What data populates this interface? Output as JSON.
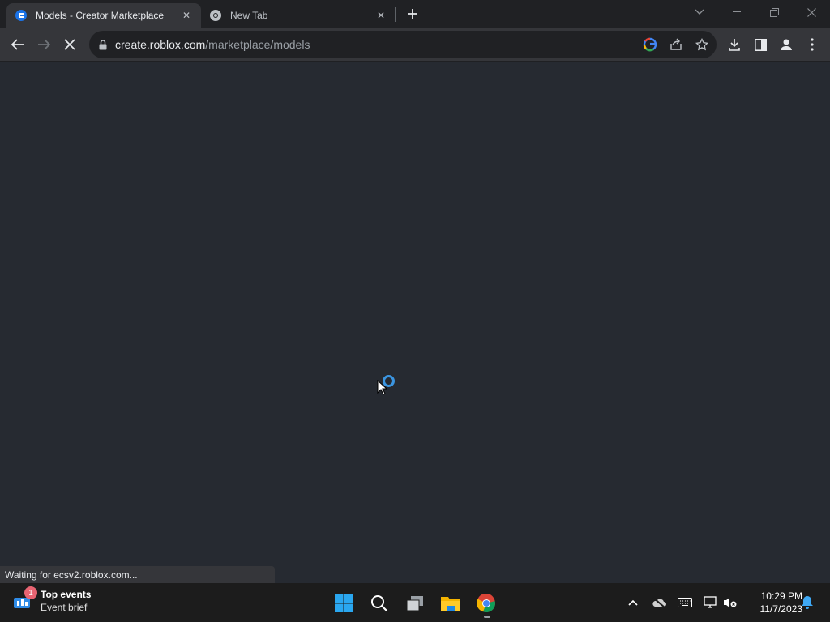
{
  "browser": {
    "tabs": [
      {
        "title": "Models - Creator Marketplace",
        "active": true
      },
      {
        "title": "New Tab",
        "active": false
      }
    ],
    "url_host": "create.roblox.com",
    "url_path": "/marketplace/models"
  },
  "status": {
    "text": "Waiting for ecsv2.roblox.com..."
  },
  "taskbar": {
    "widget_title": "Top events",
    "widget_subtitle": "Event brief",
    "widget_badge": "1",
    "time": "10:29 PM",
    "date": "11/7/2023"
  },
  "colors": {
    "page_bg": "#262a31",
    "tabstrip_bg": "#202124",
    "toolbar_bg": "#35363a",
    "spinner": "#3b95e0",
    "taskbar_bg": "#1c1c1c"
  }
}
